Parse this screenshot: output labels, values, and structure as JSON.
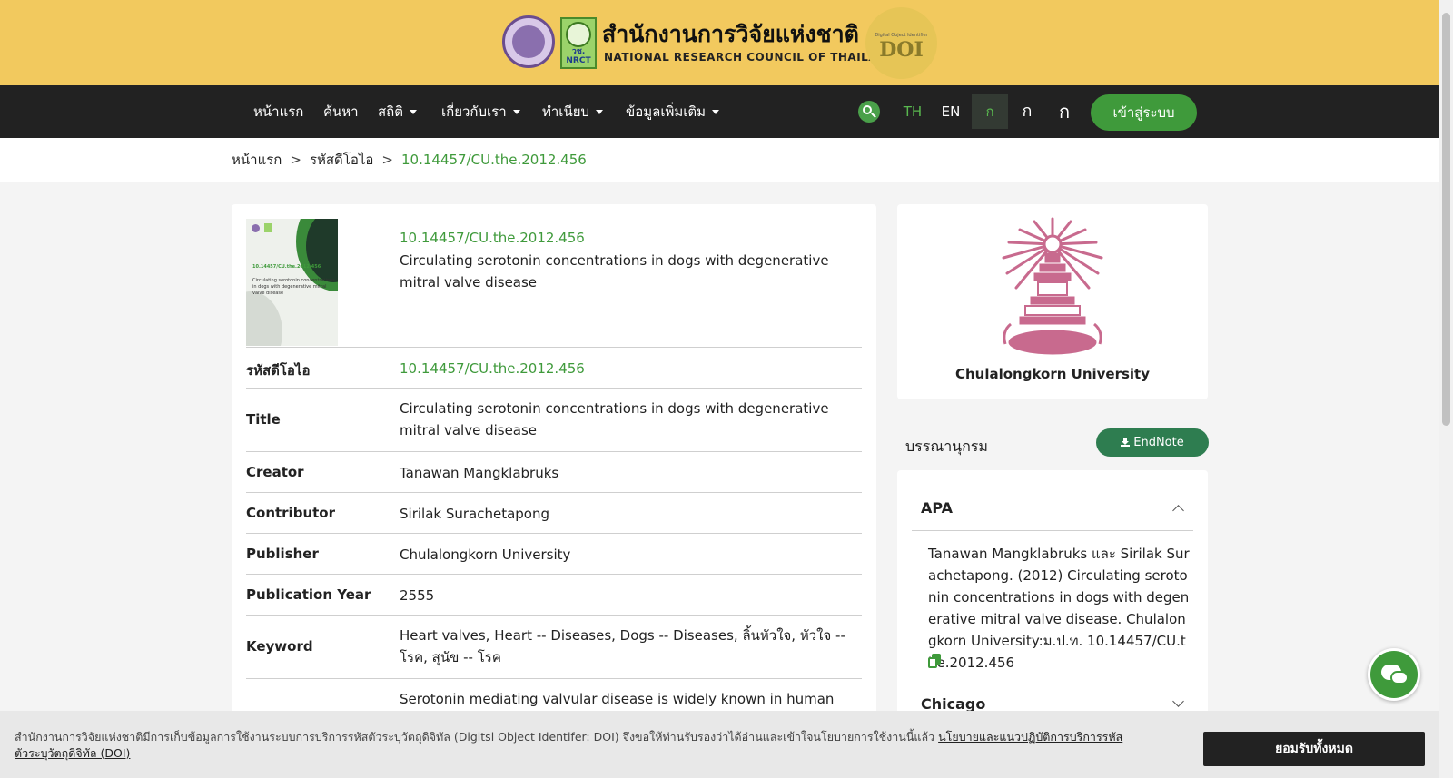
{
  "header": {
    "org_th": "สำนักงานการวิจัยแห่งชาติ",
    "org_en": "NATIONAL RESEARCH COUNCIL OF THAILAND",
    "nrct_logo_text": "วช.\nNRCT",
    "doi_logo_small": "Digital Object Identifier",
    "doi_logo_big": "DOI"
  },
  "nav": {
    "items": [
      {
        "label": "หน้าแรก",
        "dropdown": false
      },
      {
        "label": "ค้นหา",
        "dropdown": false
      },
      {
        "label": "สถิติ",
        "dropdown": true
      },
      {
        "label": "เกี่ยวกับเรา",
        "dropdown": true
      },
      {
        "label": "ทำเนียบ",
        "dropdown": true
      },
      {
        "label": "ข้อมูลเพิ่มเติม",
        "dropdown": true
      }
    ],
    "lang_th": "TH",
    "lang_en": "EN",
    "font_small": "ก",
    "font_medium": "ก",
    "font_large": "ก",
    "login": "เข้าสู่ระบบ"
  },
  "breadcrumb": {
    "home": "หน้าแรก",
    "section": "รหัสดีโอไอ",
    "current": "10.14457/CU.the.2012.456",
    "sep": ">"
  },
  "record": {
    "thumb_doi": "10.14457/CU.the.2012.456",
    "thumb_title": "Circulating serotonin concentrations in dogs with degenerative mitral valve disease",
    "doi": "10.14457/CU.the.2012.456",
    "title": "Circulating serotonin concentrations in dogs with degenerative mitral valve disease",
    "fields": [
      {
        "label": "รหัสดีโอไอ",
        "value": "10.14457/CU.the.2012.456"
      },
      {
        "label": "Title",
        "value": "Circulating serotonin concentrations in dogs with degenerative mitral valve disease"
      },
      {
        "label": "Creator",
        "value": "Tanawan Mangklabruks"
      },
      {
        "label": "Contributor",
        "value": "Sirilak Surachetapong"
      },
      {
        "label": "Publisher",
        "value": "Chulalongkorn University"
      },
      {
        "label": "Publication Year",
        "value": "2555"
      },
      {
        "label": "Keyword",
        "value": "Heart valves, Heart -- Diseases, Dogs -- Diseases, ลิ้นหัวใจ, หัวใจ -- โรค, สุนัข -- โรค"
      },
      {
        "label": "",
        "value": "Serotonin mediating valvular disease is widely known in human"
      }
    ]
  },
  "sidebar": {
    "university": "Chulalongkorn University",
    "bibliography": "บรรณานุกรม",
    "endnote": "EndNote",
    "apa_label": "APA",
    "apa_text": "Tanawan Mangklabruks และ Sirilak Surachetapong. (2012) Circulating serotonin concentrations in dogs with degenerative mitral valve disease. Chulalongkorn University:ม.ป.ท. 10.14457/CU.the.2012.456",
    "chicago_label": "Chicago"
  },
  "cookie": {
    "text": "สำนักงานการวิจัยแห่งชาติมีการเก็บข้อมูลการใช้งานระบบการบริการรหัสตัวระบุวัตถุดิจิทัล (Digitsl Object Identifer: DOI) จึงขอให้ท่านรับรองว่าได้อ่านและเข้าใจนโยบายการใช้งานนี้แล้ว",
    "link": "นโยบายและแนวปฏิบัติการบริการรหัสตัวระบุวัตถุดิจิทัล (DOI)",
    "accept": "ยอมรับทั้งหมด"
  },
  "colors": {
    "banner": "#f2c95e",
    "nav": "#222222",
    "accent_green": "#3f9a3b",
    "endnote": "#2e7d50",
    "emblem": "#c86a8e"
  }
}
